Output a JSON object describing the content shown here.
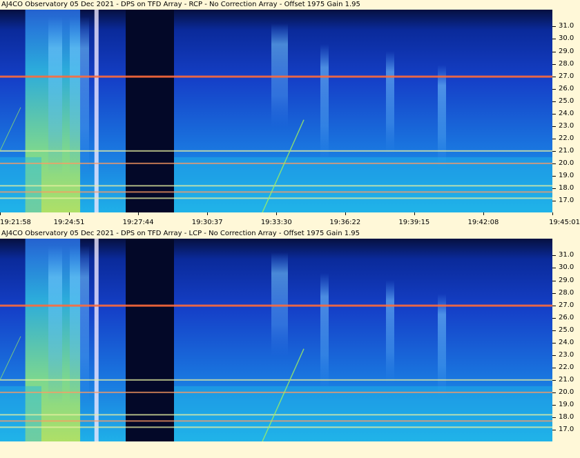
{
  "colors": {
    "background": "#fff8d8",
    "plot_top": "#061040",
    "plot_mid": "#1540c8",
    "plot_bottom": "#1fb0e8",
    "interference": "#ff6a3a"
  },
  "chart_data": [
    {
      "type": "heatmap",
      "title": "AJ4CO Observatory 05 Dec 2021 - DPS on TFD Array  - RCP  -  No Correction Array  -  Offset 1975  Gain 1.95",
      "xlabel": "",
      "ylabel": "",
      "x_ticks": [
        "19:21:58",
        "19:24:51",
        "19:27:44",
        "19:30:37",
        "19:33:30",
        "19:36:22",
        "19:39:15",
        "19:42:08",
        "19:45:01"
      ],
      "y_ticks": [
        "17.0",
        "18.0",
        "19.0",
        "20.0",
        "21.0",
        "22.0",
        "23.0",
        "24.0",
        "25.0",
        "26.0",
        "27.0",
        "28.0",
        "29.0",
        "30.0",
        "31.0"
      ],
      "ylim": [
        16.5,
        31.8
      ],
      "interference_lines_mhz": [
        27.0,
        21.0,
        20.0,
        18.2,
        17.7,
        17.2
      ],
      "bright_bands_time": [
        [
          "19:23:10",
          "19:25:10"
        ],
        [
          "19:26:10",
          "19:27:30"
        ]
      ]
    },
    {
      "type": "heatmap",
      "title": "AJ4CO Observatory 05 Dec 2021 - DPS on TFD Array  - LCP  -  No Correction Array  -  Offset 1975  Gain 1.95",
      "xlabel": "",
      "ylabel": "",
      "x_ticks": [],
      "y_ticks": [
        "17.0",
        "18.0",
        "19.0",
        "20.0",
        "21.0",
        "22.0",
        "23.0",
        "24.0",
        "25.0",
        "26.0",
        "27.0",
        "28.0",
        "29.0",
        "30.0",
        "31.0"
      ],
      "ylim": [
        16.5,
        31.8
      ],
      "interference_lines_mhz": [
        27.0,
        21.0,
        20.0,
        18.2,
        17.7,
        17.2
      ],
      "bright_bands_time": [
        [
          "19:23:10",
          "19:25:10"
        ],
        [
          "19:26:10",
          "19:27:30"
        ]
      ]
    }
  ]
}
